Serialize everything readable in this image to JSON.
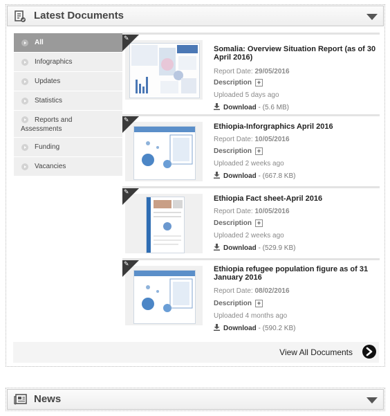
{
  "latest": {
    "title": "Latest Documents",
    "header_icon": "document-icon",
    "toggle_icon": "chevron-down-icon"
  },
  "sidebar": {
    "items": [
      {
        "label": "All",
        "active": true
      },
      {
        "label": "Infographics"
      },
      {
        "label": "Updates"
      },
      {
        "label": "Statistics"
      },
      {
        "label": "Reports and Assessments"
      },
      {
        "label": "Funding"
      },
      {
        "label": "Vacancies"
      }
    ]
  },
  "documents": [
    {
      "title": "Somalia: Overview Situation Report (as of 30 April 2016)",
      "report_date_label": "Report Date: ",
      "report_date": "29/05/2016",
      "description_label": "Description",
      "uploaded": "Uploaded 5 days ago",
      "download_label": "Download",
      "download_size": " - (5.6 MB)"
    },
    {
      "title": "Ethiopia-Inforgraphics April 2016",
      "report_date_label": "Report Date: ",
      "report_date": "10/05/2016",
      "description_label": "Description",
      "uploaded": "Uploaded 2 weeks ago",
      "download_label": "Download",
      "download_size": " - (667.8 KB)"
    },
    {
      "title": "Ethiopia Fact sheet-April 2016",
      "report_date_label": "Report Date: ",
      "report_date": "10/05/2016",
      "description_label": "Description",
      "uploaded": "Uploaded 2 weeks ago",
      "download_label": "Download",
      "download_size": " - (529.9 KB)"
    },
    {
      "title": "Ethiopia refugee population figure as of 31 January 2016",
      "report_date_label": "Report Date: ",
      "report_date": "08/02/2016",
      "description_label": "Description",
      "uploaded": "Uploaded 4 months ago",
      "download_label": "Download",
      "download_size": " - (590.2 KB)"
    }
  ],
  "view_all": {
    "label": "View All Documents"
  },
  "news": {
    "title": "News",
    "header_icon": "newspaper-icon"
  }
}
